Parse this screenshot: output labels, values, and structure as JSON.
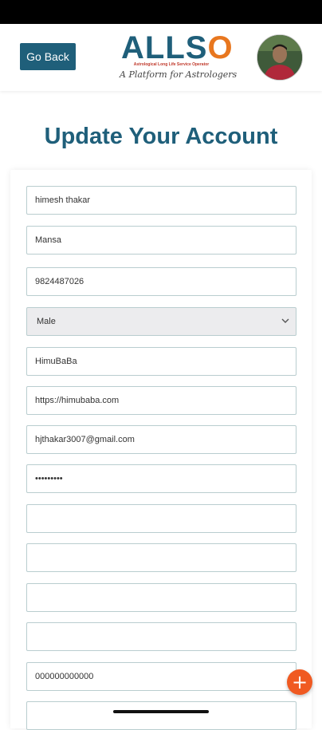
{
  "header": {
    "back_label": "Go Back",
    "logo_text_a": "ALLS",
    "logo_text_o": "O",
    "logo_subtitle": "Astrological Long Life Service Operator",
    "logo_tagline": "A Platform for Astrologers"
  },
  "page": {
    "title": "Update Your Account"
  },
  "form": {
    "fields": [
      {
        "value": "himesh thakar"
      },
      {
        "value": "Mansa"
      },
      {
        "value": "9824487026"
      },
      {
        "value": "Male"
      },
      {
        "value": "HimuBaBa"
      },
      {
        "value": "https://himubaba.com"
      },
      {
        "value": "hjthakar3007@gmail.com"
      },
      {
        "value": "•••••••••"
      },
      {
        "value": ""
      },
      {
        "value": ""
      },
      {
        "value": ""
      },
      {
        "value": ""
      },
      {
        "value": "000000000000"
      },
      {
        "value": ""
      }
    ]
  },
  "colors": {
    "brand": "#1f5f7a",
    "accent": "#e8771f",
    "fab": "#f05a22"
  },
  "icons": {
    "fab": "plus-icon",
    "select": "chevron-down-icon"
  }
}
